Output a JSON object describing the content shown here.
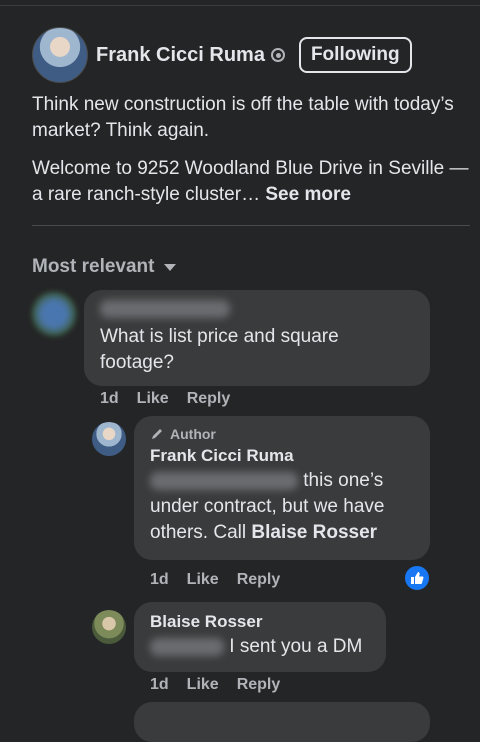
{
  "post": {
    "author": "Frank Cicci Ruma",
    "follow_label": "Following",
    "text_1": "Think new construction is off the table with today’s market? Think again.",
    "text_2": "Welcome to 9252 Woodland Blue Drive in Seville — a rare ranch-style cluster…",
    "see_more": "See more"
  },
  "comments": {
    "sort_label": "Most relevant",
    "items": [
      {
        "text": "What is list price and square footage?",
        "time": "1d",
        "like": "Like",
        "reply": "Reply"
      },
      {
        "badge": "Author",
        "author": "Frank Cicci Ruma",
        "text": "this one’s under contract, but we have others. Call",
        "mention": "Blaise Rosser",
        "time": "1d",
        "like": "Like",
        "reply": "Reply"
      },
      {
        "author": "Blaise Rosser",
        "text": "I sent you a DM",
        "time": "1d",
        "like": "Like",
        "reply": "Reply"
      }
    ]
  },
  "colors": {
    "background": "#242526",
    "bubble": "#3a3b3c",
    "text": "#e4e6eb",
    "secondary": "#b0b3b8",
    "like_blue": "#1877f2"
  }
}
